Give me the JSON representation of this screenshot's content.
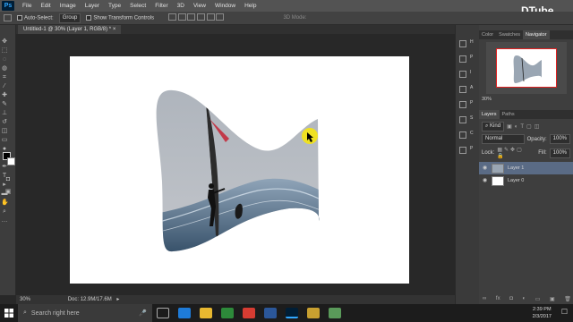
{
  "menu": {
    "items": [
      "File",
      "Edit",
      "Image",
      "Layer",
      "Type",
      "Select",
      "Filter",
      "3D",
      "View",
      "Window",
      "Help"
    ]
  },
  "options_bar": {
    "auto_select_label": "Auto-Select:",
    "auto_select_value": "Group",
    "show_transform_label": "Show Transform Controls",
    "mode_label": "3D Mode:"
  },
  "document": {
    "tab_title": "Untitled-1 @ 30% (Layer 1, RGB/8) *",
    "zoom": "30%",
    "doc_info": "Doc: 12.9M/17.6M"
  },
  "panels": {
    "top_tabs": [
      "Color",
      "Swatches",
      "Navigator"
    ],
    "navigator_zoom": "30%",
    "mini_labels": [
      "H",
      "P",
      "I",
      "A",
      "P",
      "S",
      "C",
      "P"
    ],
    "layers_tabs": [
      "Layers",
      "Paths"
    ],
    "filter_kind": "Kind",
    "blend_mode": "Normal",
    "opacity_label": "Opacity:",
    "opacity_value": "100%",
    "lock_label": "Lock:",
    "fill_label": "Fill:",
    "fill_value": "100%",
    "layers": [
      {
        "name": "Layer 1"
      },
      {
        "name": "Layer 0"
      }
    ]
  },
  "taskbar": {
    "search_placeholder": "Search right here",
    "time": "2:39 PM",
    "date": "2/3/2017"
  },
  "watermark": "DTube",
  "colors": {
    "accent": "#31a8ff",
    "cursor_highlight": "#f2e31a"
  }
}
